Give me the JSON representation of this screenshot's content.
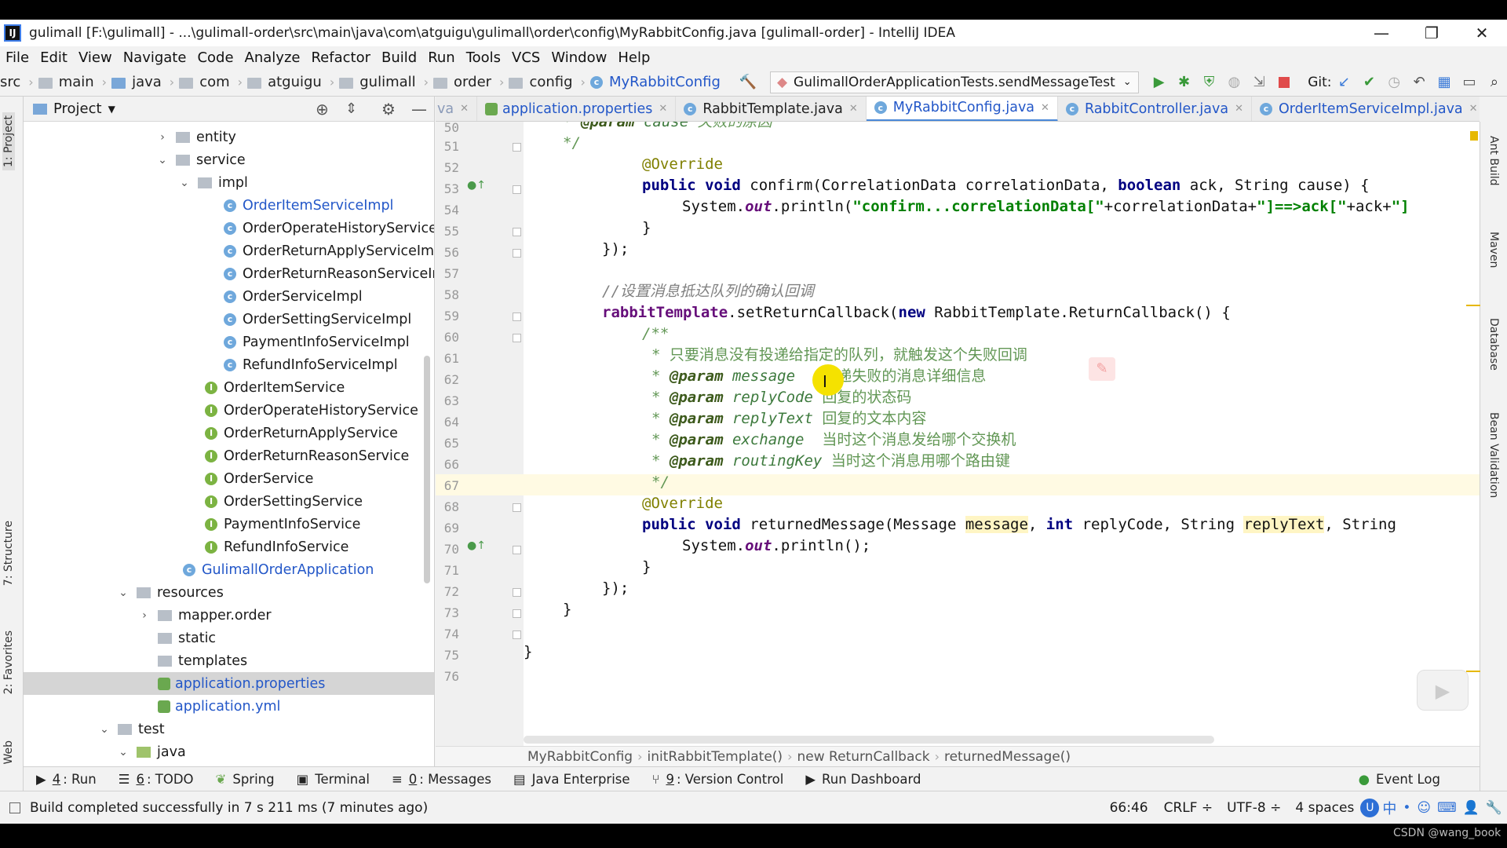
{
  "window": {
    "title": "gulimall [F:\\gulimall] - ...\\gulimall-order\\src\\main\\java\\com\\atguigu\\gulimall\\order\\config\\MyRabbitConfig.java [gulimall-order] - IntelliJ IDEA"
  },
  "menu": [
    "File",
    "Edit",
    "View",
    "Navigate",
    "Code",
    "Analyze",
    "Refactor",
    "Build",
    "Run",
    "Tools",
    "VCS",
    "Window",
    "Help"
  ],
  "nav": {
    "crumbs": [
      "src",
      "main",
      "java",
      "com",
      "atguigu",
      "gulimall",
      "order",
      "config"
    ],
    "current": "MyRabbitConfig",
    "run_config": "GulimallOrderApplicationTests.sendMessageTest",
    "git": "Git:"
  },
  "project": {
    "title": "Project",
    "rows": [
      {
        "label": "entity",
        "type": "folder"
      },
      {
        "label": "service",
        "type": "folder"
      },
      {
        "label": "impl",
        "type": "folder"
      },
      {
        "label": "OrderItemServiceImpl",
        "type": "class"
      },
      {
        "label": "OrderOperateHistoryServiceI",
        "type": "class"
      },
      {
        "label": "OrderReturnApplyServiceImp",
        "type": "class"
      },
      {
        "label": "OrderReturnReasonServiceIm",
        "type": "class"
      },
      {
        "label": "OrderServiceImpl",
        "type": "class"
      },
      {
        "label": "OrderSettingServiceImpl",
        "type": "class"
      },
      {
        "label": "PaymentInfoServiceImpl",
        "type": "class"
      },
      {
        "label": "RefundInfoServiceImpl",
        "type": "class"
      },
      {
        "label": "OrderItemService",
        "type": "interface"
      },
      {
        "label": "OrderOperateHistoryService",
        "type": "interface"
      },
      {
        "label": "OrderReturnApplyService",
        "type": "interface"
      },
      {
        "label": "OrderReturnReasonService",
        "type": "interface"
      },
      {
        "label": "OrderService",
        "type": "interface"
      },
      {
        "label": "OrderSettingService",
        "type": "interface"
      },
      {
        "label": "PaymentInfoService",
        "type": "interface"
      },
      {
        "label": "RefundInfoService",
        "type": "interface"
      },
      {
        "label": "GulimallOrderApplication",
        "type": "class"
      },
      {
        "label": "resources",
        "type": "folder"
      },
      {
        "label": "mapper.order",
        "type": "folder"
      },
      {
        "label": "static",
        "type": "folder"
      },
      {
        "label": "templates",
        "type": "folder"
      },
      {
        "label": "application.properties",
        "type": "props"
      },
      {
        "label": "application.yml",
        "type": "props"
      },
      {
        "label": "test",
        "type": "folder"
      },
      {
        "label": "java",
        "type": "folder"
      }
    ]
  },
  "tabs": [
    {
      "label": "va"
    },
    {
      "label": "application.properties"
    },
    {
      "label": "RabbitTemplate.java"
    },
    {
      "label": "MyRabbitConfig.java",
      "active": true
    },
    {
      "label": "RabbitController.java"
    },
    {
      "label": "OrderItemServiceImpl.java"
    }
  ],
  "editor": {
    "line_numbers": [
      "50",
      "51",
      "52",
      "53",
      "54",
      "55",
      "56",
      "57",
      "58",
      "59",
      "60",
      "61",
      "62",
      "63",
      "64",
      "65",
      "66",
      "67",
      "68",
      "69",
      "70",
      "71",
      "72",
      "73",
      "74",
      "75",
      "76"
    ],
    "current_line": "66"
  },
  "code": {
    "l50a": "* ",
    "l50b": "@param",
    "l50c": " cause ",
    "l50d": "失败的原因",
    "l51": "*/",
    "l52": "@Override",
    "l53a": "public void ",
    "l53b": "confirm(CorrelationData correlationData, ",
    "l53c": "boolean ",
    "l53d": "ack, String cause) {",
    "l54a": "System.",
    "l54b": "out",
    "l54c": ".println(",
    "l54d": "\"confirm...correlationData[\"",
    "l54e": "+correlationData+",
    "l54f": "\"]==>ack[\"",
    "l54g": "+ack+",
    "l54h": "\"]",
    "l55": "}",
    "l56": "});",
    "l58": "//设置消息抵达队列的确认回调",
    "l59a": "rabbitTemplate",
    ".l59b": "",
    "l59b": ".setReturnCallback(",
    "l59c": "new ",
    "l59d": "RabbitTemplate.ReturnCallback() {",
    "l60": "/**",
    "l61": "* 只要消息没有投递给指定的队列，就触发这个失败回调",
    "l62a": "* ",
    "l62b": "@param",
    "l62c": " message  ",
    "l62d": " 投递失败的消息详细信息",
    "l63a": "* ",
    "l63b": "@param",
    "l63c": " replyCode ",
    "l63d": "回复的状态码",
    "l64a": "* ",
    "l64b": "@param",
    "l64c": " replyText ",
    "l64d": "回复的文本内容",
    "l65a": "* ",
    "l65b": "@param",
    "l65c": " exchange  ",
    "l65d": "当时这个消息发给哪个交换机",
    "l66a": "* ",
    "l66b": "@param",
    "l66c": " routingKey ",
    "l66d": "当时这个消息用哪个路由键",
    "l67": "*/",
    "l68": "@Override",
    "l69a": "public void ",
    "l69b": "returnedMessage(Message ",
    "l69c": "message",
    ".x": "",
    "l69d": ", ",
    "l69e": "int ",
    "l69f": "replyCode, String ",
    "l69g": "replyText",
    ".y": "",
    "l69h": ", String",
    "l70a": "System.",
    "l70b": "out",
    "l70c": ".println();",
    "l71": "}",
    "l72": "});",
    "l73": "}",
    "l75": "}"
  },
  "breadcrumb": [
    "MyRabbitConfig",
    "initRabbitTemplate()",
    "new ReturnCallback",
    "returnedMessage()"
  ],
  "bottom_tools": [
    {
      "key": "4",
      "label": ": Run"
    },
    {
      "key": "6",
      "label": ": TODO"
    },
    {
      "key": "",
      "label": "Spring"
    },
    {
      "key": "",
      "label": "Terminal"
    },
    {
      "key": "0",
      "label": ": Messages"
    },
    {
      "key": "",
      "label": "Java Enterprise"
    },
    {
      "key": "9",
      "label": ": Version Control"
    },
    {
      "key": "",
      "label": "Run Dashboard"
    }
  ],
  "event_log": "Event Log",
  "right_tools": [
    "Ant Build",
    "Maven",
    "Database",
    "Bean Validation"
  ],
  "left_tools": [
    "1: Project",
    "7: Structure",
    "2: Favorites",
    "Web"
  ],
  "status": {
    "message": "Build completed successfully in 7 s 211 ms (7 minutes ago)",
    "position": "66:46",
    "line_sep": "CRLF ÷",
    "encoding": "UTF-8 ÷",
    "indent": "4 spaces",
    "ime": "中"
  },
  "watermark": "CSDN @wang_book"
}
